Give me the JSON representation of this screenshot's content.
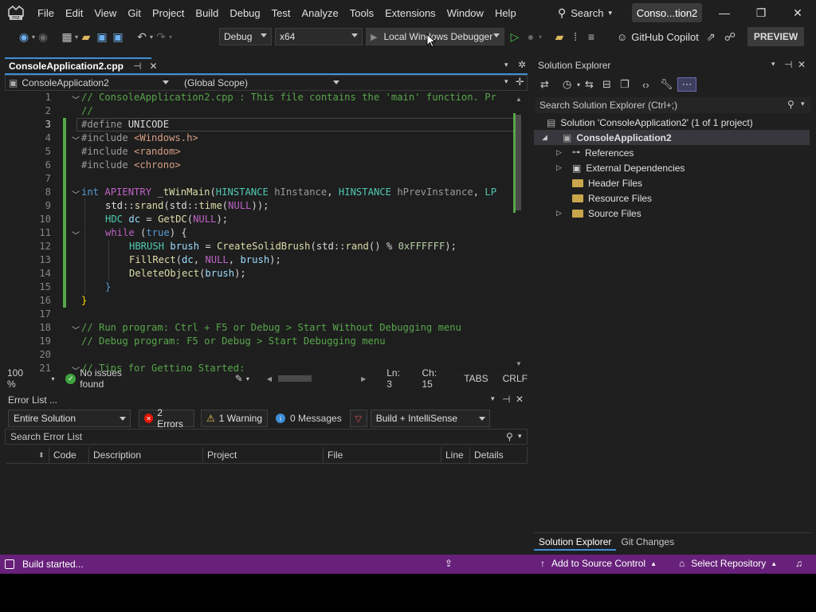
{
  "menu": [
    "File",
    "Edit",
    "View",
    "Git",
    "Project",
    "Build",
    "Debug",
    "Test",
    "Analyze",
    "Tools",
    "Extensions",
    "Window",
    "Help"
  ],
  "search_label": "Search",
  "window_title": "Conso...tion2",
  "toolbar": {
    "config": "Debug",
    "platform": "x64",
    "run_target": "Local Windows Debugger",
    "copilot": "GitHub Copilot",
    "preview": "PREVIEW"
  },
  "editor": {
    "tab_name": "ConsoleApplication2.cpp",
    "project_dropdown": "ConsoleApplication2",
    "scope_dropdown": "(Global Scope)",
    "zoom": "100 %",
    "issues": "No issues found",
    "ln": "Ln: 3",
    "ch": "Ch: 15",
    "tabs": "TABS",
    "eol": "CRLF",
    "line_numbers": [
      "1",
      "2",
      "3",
      "4",
      "5",
      "6",
      "7",
      "8",
      "9",
      "10",
      "11",
      "12",
      "13",
      "14",
      "15",
      "16",
      "17",
      "18",
      "19",
      "20",
      "21"
    ]
  },
  "errorlist": {
    "title": "Error List ...",
    "scope": "Entire Solution",
    "errors": "2 Errors",
    "warnings": "1 Warning",
    "messages": "0 Messages",
    "build_filter": "Build + IntelliSense",
    "search_placeholder": "Search Error List",
    "columns": [
      "Code",
      "Description",
      "Project",
      "File",
      "Line",
      "Details"
    ]
  },
  "solution_explorer": {
    "title": "Solution Explorer",
    "search_placeholder": "Search Solution Explorer (Ctrl+;)",
    "solution": "Solution 'ConsoleApplication2' (1 of 1 project)",
    "project": "ConsoleApplication2",
    "items": [
      "References",
      "External Dependencies",
      "Header Files",
      "Resource Files",
      "Source Files"
    ],
    "tabs": [
      "Solution Explorer",
      "Git Changes"
    ]
  },
  "statusbar": {
    "message": "Build started...",
    "source_control": "Add to Source Control",
    "repository": "Select Repository"
  }
}
